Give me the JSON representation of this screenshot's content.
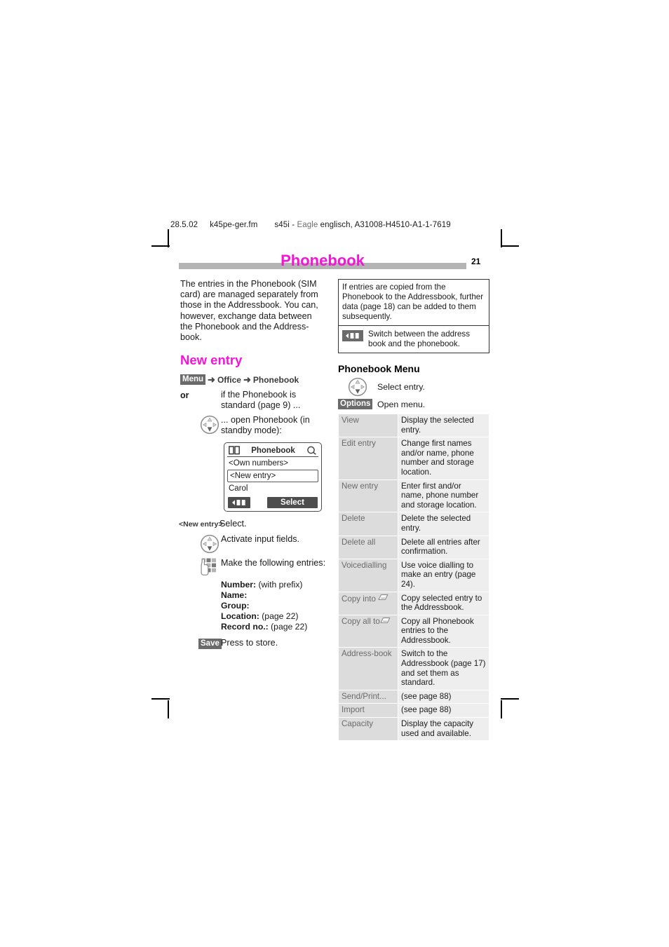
{
  "doc_header": {
    "date": "28.5.02",
    "filename": "k45pe-ger.fm",
    "product": "s45i - ",
    "codename": "Eagle",
    "doc_ref": " englisch, A31008-H4510-A1-1-7619"
  },
  "page": {
    "title": "Phonebook",
    "number": "21",
    "title_color": "#f712d8",
    "band_color": "#b4b4b4"
  },
  "left": {
    "intro": "The entries in the Phonebook (SIM card) are managed separately from those in the Addressbook. You can, however, exchange data between the Phonebook and the Address-book.",
    "section_heading": "New entry",
    "path": {
      "menu_badge": "Menu",
      "crumb1": "Office",
      "crumb2": "Phonebook",
      "arrow": "➜"
    },
    "or_label": "or",
    "or_text": "if the Phonebook is standard (page 9) ...",
    "open_text": "... open Phonebook (in standby mode):",
    "phone_mock": {
      "title": "Phonebook",
      "book_icon": "book-icon",
      "search_icon": "magnifier-icon",
      "line1": "<Own numbers>",
      "line2": "<New entry>",
      "line3": "Carol",
      "softkey_left_icon": "swap-book-icon",
      "softkey_right": "Select"
    },
    "select_row": {
      "label": "<New entry>",
      "text": "Select."
    },
    "activate_row": {
      "icon": "navigation-key-icon",
      "text": "Activate input fields."
    },
    "keypad_row": {
      "icon": "keypad-hand-icon",
      "text": "Make the following entries:"
    },
    "fields": [
      {
        "label": "Number:",
        "value": " (with prefix)"
      },
      {
        "label": "Name:",
        "value": ""
      },
      {
        "label": "Group:",
        "value": ""
      },
      {
        "label": "Location:",
        "value": " (page 22)"
      },
      {
        "label": "Record no.:",
        "value": " (page 22)"
      }
    ],
    "save_row": {
      "badge": "Save",
      "text": "Press to store."
    }
  },
  "right": {
    "note": {
      "text": "If entries are copied from the Phonebook to the Addressbook, further data (page 18) can be added to them subsequently.",
      "icon": "swap-book-icon",
      "icon_text": "Switch between the address book and the phonebook."
    },
    "menu_heading": "Phonebook Menu",
    "menu_instructions": [
      {
        "icon": "navigation-key-icon",
        "badge": "",
        "text": "Select entry."
      },
      {
        "icon": "",
        "badge": "Options",
        "text": "Open menu."
      }
    ],
    "menu_table": {
      "rows": [
        {
          "label": "View",
          "icon": "",
          "desc": "Display the selected entry."
        },
        {
          "label": "Edit entry",
          "icon": "",
          "desc": "Change first names and/or name, phone number and storage location."
        },
        {
          "label": "New entry",
          "icon": "",
          "desc": "Enter first and/or name, phone number and storage location."
        },
        {
          "label": "Delete",
          "icon": "",
          "desc": "Delete the selected entry."
        },
        {
          "label": "Delete all",
          "icon": "",
          "desc": "Delete all entries after confirmation."
        },
        {
          "label": "Voicedialling",
          "icon": "",
          "desc": "Use voice dialling to make an entry (page 24)."
        },
        {
          "label": "Copy into",
          "icon": "addressbook-card-icon",
          "desc": "Copy selected entry to the Addressbook."
        },
        {
          "label": "Copy all to",
          "icon": "addressbook-card-icon",
          "desc": "Copy all Phonebook entries to the Addressbook."
        },
        {
          "label": "Address-book",
          "icon": "",
          "desc": "Switch to the Addressbook (page 17) and set them as standard."
        },
        {
          "label": "Send/Print...",
          "icon": "",
          "desc": "(see page 88)"
        },
        {
          "label": "Import",
          "icon": "",
          "desc": "(see page 88)"
        },
        {
          "label": "Capacity",
          "icon": "",
          "desc": "Display the capacity used and available."
        }
      ]
    }
  }
}
